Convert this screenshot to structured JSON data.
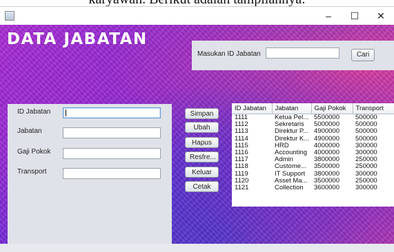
{
  "page_header": {
    "text": "karyawan. Berikut adalah tampilannya:"
  },
  "window": {
    "controls": {
      "minimize": "–",
      "maximize": "☐",
      "close": "✕"
    }
  },
  "app": {
    "title": "DATA JABATAN"
  },
  "search": {
    "label": "Masukan ID Jabatan",
    "value": "",
    "button": "Cari"
  },
  "form": {
    "fields": [
      {
        "label": "ID Jabatan",
        "value": ""
      },
      {
        "label": "Jabatan",
        "value": ""
      },
      {
        "label": "Gaji Pokok",
        "value": ""
      },
      {
        "label": "Transport",
        "value": ""
      }
    ]
  },
  "actions": [
    "Simpan",
    "Ubah",
    "Hapus",
    "Resfre...",
    "Keluar",
    "Cetak"
  ],
  "table": {
    "columns": [
      "ID Jabatan",
      "Jabatan",
      "Gaji Pokok",
      "Transport"
    ],
    "rows": [
      [
        "1111",
        "Ketua Pel...",
        "5500000",
        "500000"
      ],
      [
        "1112",
        "Sekretaris",
        "5000000",
        "500000"
      ],
      [
        "1113",
        "Direktur P...",
        "4900000",
        "500000"
      ],
      [
        "1114",
        "Direktur K...",
        "4900000",
        "500000"
      ],
      [
        "1115",
        "HRD",
        "4000000",
        "300000"
      ],
      [
        "1116",
        "Accounting",
        "4000000",
        "300000"
      ],
      [
        "1117",
        "Admin",
        "3800000",
        "250000"
      ],
      [
        "1118",
        "Custome...",
        "3500000",
        "250000"
      ],
      [
        "1119",
        "IT Support",
        "3800000",
        "300000"
      ],
      [
        "1120",
        "Asset Ma...",
        "3500000",
        "250000"
      ],
      [
        "1121",
        "Collection",
        "3600000",
        "300000"
      ]
    ]
  }
}
